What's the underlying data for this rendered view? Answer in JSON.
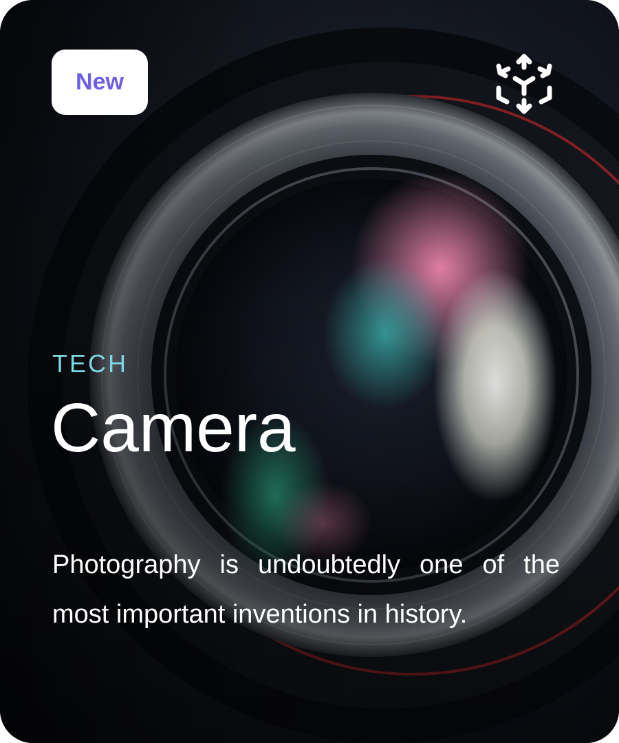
{
  "card": {
    "badge_label": "New",
    "category": "TECH",
    "title": "Camera",
    "description": "Photography is undoubtedly one of the most important inventions in history.",
    "ar_icon": "ar-cube-icon",
    "image_subject": "camera-lens-photo"
  },
  "colors": {
    "badge_text": "#6e5ee6",
    "category_text": "#7ad7e6",
    "background": "#0b0d14"
  }
}
